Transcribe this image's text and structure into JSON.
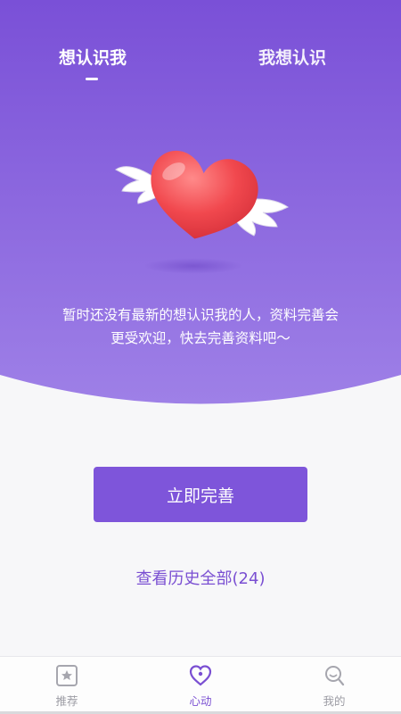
{
  "tabs": [
    {
      "label": "想认识我"
    },
    {
      "label": "我想认识"
    }
  ],
  "empty_state": {
    "line1": "暂时还没有最新的想认识我的人，资料完善会",
    "line2": "更受欢迎，快去完善资料吧～"
  },
  "actions": {
    "complete_profile_label": "立即完善",
    "history_link_label": "查看历史全部(24)"
  },
  "bottom_nav": [
    {
      "label": "推荐",
      "icon": "recommend-icon",
      "active": false
    },
    {
      "label": "心动",
      "icon": "heart-icon",
      "active": true
    },
    {
      "label": "我的",
      "icon": "profile-icon",
      "active": false
    }
  ],
  "colors": {
    "hero_top": "#7b52d8",
    "hero_bottom": "#9d7ee6",
    "accent": "#7e55da",
    "heart": "#ef4b50",
    "page_bg": "#f7f7f9"
  }
}
